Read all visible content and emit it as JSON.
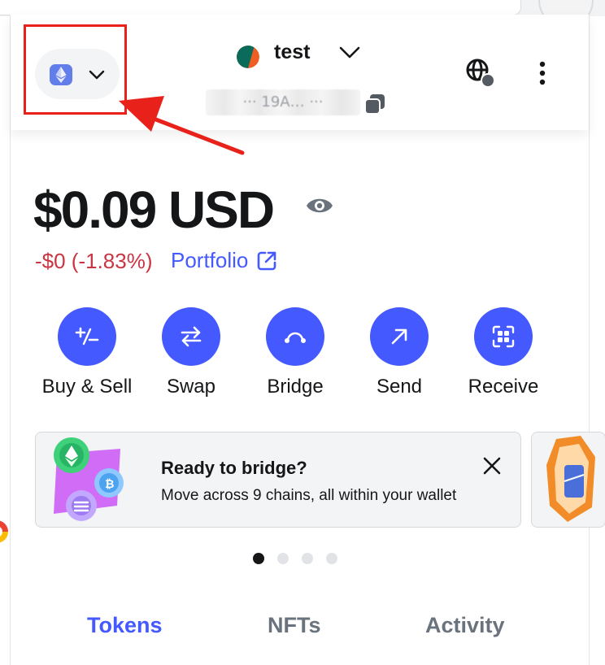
{
  "header": {
    "account_name": "test",
    "address_masked": "··· 19A… ···"
  },
  "balance": {
    "amount": "$0.09 USD",
    "change": "-$0 (-1.83%)",
    "portfolio_label": "Portfolio"
  },
  "actions": [
    {
      "label": "Buy & Sell",
      "icon": "plus-minus-icon"
    },
    {
      "label": "Swap",
      "icon": "swap-arrows-icon"
    },
    {
      "label": "Bridge",
      "icon": "bridge-icon"
    },
    {
      "label": "Send",
      "icon": "arrow-up-right-icon"
    },
    {
      "label": "Receive",
      "icon": "qr-scan-icon"
    }
  ],
  "banner": {
    "title": "Ready to bridge?",
    "description": "Move across 9 chains, all within your wallet"
  },
  "carousel": {
    "total": 4,
    "active_index": 0
  },
  "tabs": [
    {
      "label": "Tokens",
      "active": true
    },
    {
      "label": "NFTs",
      "active": false
    },
    {
      "label": "Activity",
      "active": false
    }
  ],
  "colors": {
    "primary": "#4459ff",
    "negative": "#ca3542",
    "text": "#141618",
    "annotation_red": "#e8221a",
    "eth": "#627eea"
  }
}
